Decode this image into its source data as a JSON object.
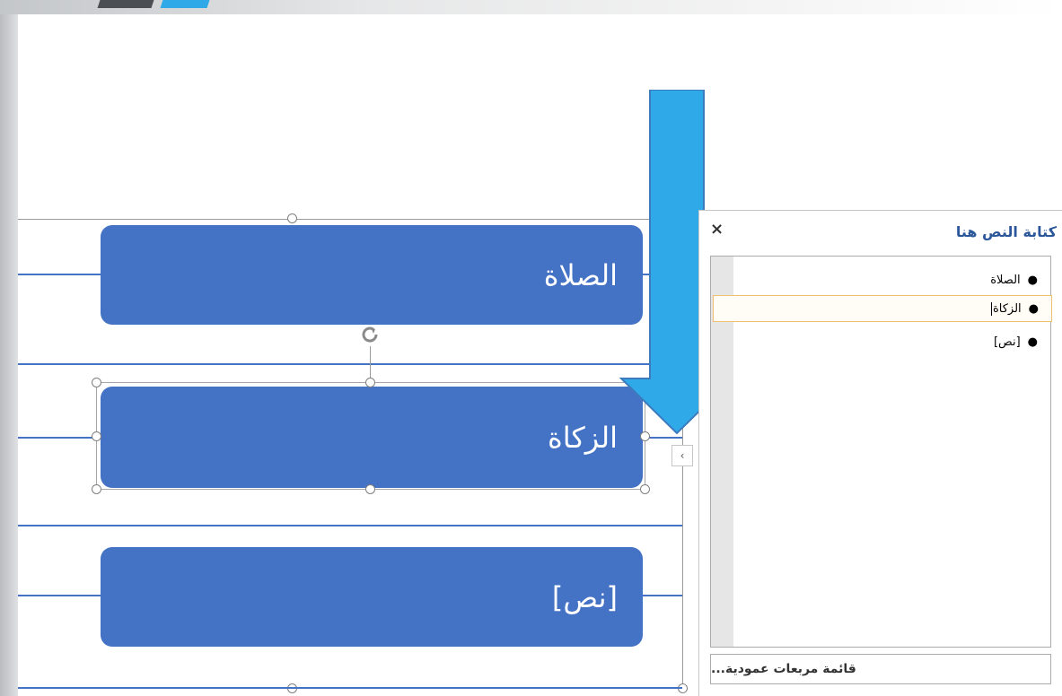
{
  "slide": {
    "nodes": [
      {
        "label": "الصلاة"
      },
      {
        "label": "الزكاة"
      },
      {
        "label": "[نص]"
      }
    ]
  },
  "text_pane": {
    "title": "كتابة النص هنا",
    "close": "×",
    "items": [
      {
        "label": "الصلاة"
      },
      {
        "label": "الزكاة"
      },
      {
        "label": "[نص]"
      }
    ],
    "footer": "قائمة مربعات عمودية..."
  },
  "collapse_button": "‹",
  "colors": {
    "node_fill": "#4472c4",
    "arrow_fill": "#2fa9e8",
    "pane_title": "#2b579a",
    "active_item_border": "#f0c070"
  },
  "icons": {
    "rotate": "rotate-handle-icon",
    "arrow": "down-arrow-icon",
    "collapse": "chevron-left-icon"
  }
}
